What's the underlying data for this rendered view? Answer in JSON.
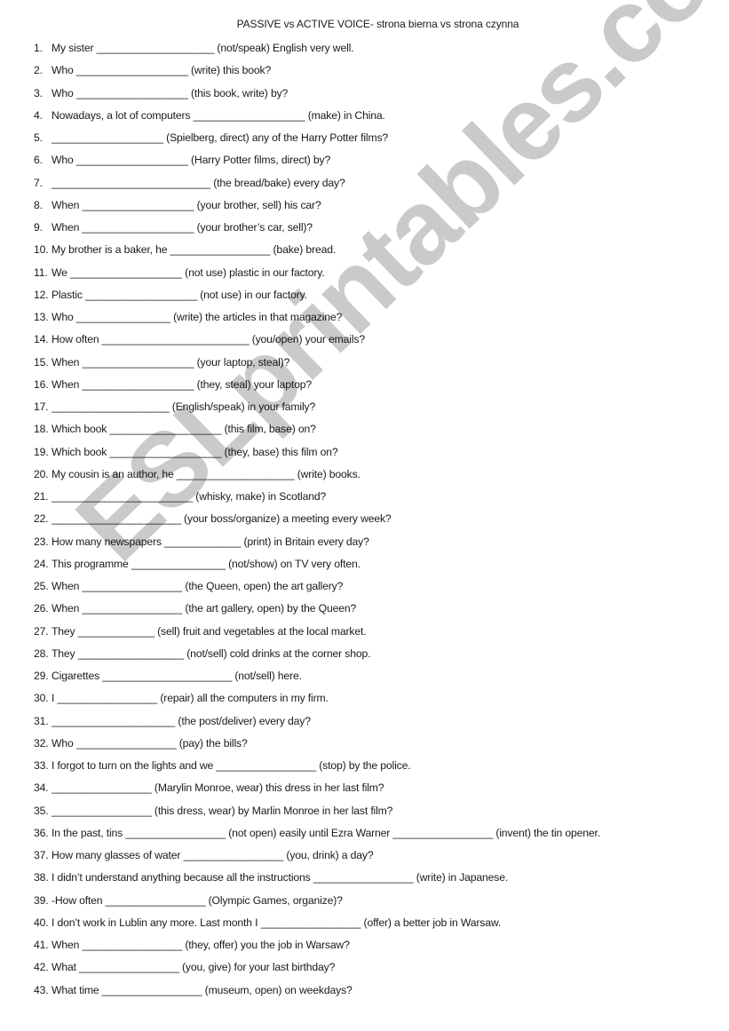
{
  "title": "PASSIVE vs ACTIVE VOICE- strona bierna vs strona czynna",
  "watermark": "ESLprintables.com",
  "items": [
    {
      "num": "1.",
      "text": "My sister ____________________ (not/speak) English very well."
    },
    {
      "num": "2.",
      "text": "Who ___________________ (write) this book?"
    },
    {
      "num": "3.",
      "text": "Who ___________________ (this book, write) by?"
    },
    {
      "num": "4.",
      "text": "Nowadays, a lot of computers ___________________ (make) in China."
    },
    {
      "num": "5.",
      "text": "___________________ (Spielberg, direct) any of the Harry Potter films?"
    },
    {
      "num": "6.",
      "text": "Who ___________________ (Harry Potter films, direct) by?"
    },
    {
      "num": "7.",
      "text": "___________________________ (the bread/bake) every day?"
    },
    {
      "num": "8.",
      "text": "When ___________________ (your brother, sell) his car?"
    },
    {
      "num": "9.",
      "text": "When ___________________ (your brother’s car, sell)?"
    },
    {
      "num": "10.",
      "text": "My brother is a baker, he _________________ (bake) bread."
    },
    {
      "num": "11.",
      "text": "We ___________________ (not use) plastic in our factory."
    },
    {
      "num": "12.",
      "text": "Plastic ___________________ (not use) in our factory."
    },
    {
      "num": "13.",
      "text": "Who ________________ (write) the articles in that magazine?"
    },
    {
      "num": "14.",
      "text": "How often _________________________ (you/open) your emails?"
    },
    {
      "num": "15.",
      "text": "When ___________________ (your laptop, steal)?"
    },
    {
      "num": "16.",
      "text": "When ___________________ (they, steal) your laptop?"
    },
    {
      "num": "17.",
      "text": "____________________ (English/speak) in your family?"
    },
    {
      "num": "18.",
      "text": "Which book ___________________ (this film, base) on?"
    },
    {
      "num": "19.",
      "text": "Which book ___________________ (they, base) this film on?"
    },
    {
      "num": "20.",
      "text": "My cousin is an author, he ____________________ (write) books."
    },
    {
      "num": "21.",
      "text": "________________________ (whisky, make) in Scotland?"
    },
    {
      "num": "22.",
      "text": "______________________ (your boss/organize) a meeting every week?"
    },
    {
      "num": "23.",
      "text": "How many newspapers _____________ (print) in Britain every day?"
    },
    {
      "num": "24.",
      "text": "This programme ________________ (not/show) on TV very often."
    },
    {
      "num": "25.",
      "text": "When _________________ (the Queen, open) the art gallery?"
    },
    {
      "num": "26.",
      "text": "When _________________ (the art gallery, open) by the Queen?"
    },
    {
      "num": "27.",
      "text": "They _____________ (sell) fruit and vegetables at the local market."
    },
    {
      "num": "28.",
      "text": "They __________________ (not/sell) cold drinks at the corner shop."
    },
    {
      "num": "29.",
      "text": "Cigarettes ______________________ (not/sell) here."
    },
    {
      "num": "30.",
      "text": "I _________________ (repair) all the computers in my firm."
    },
    {
      "num": "31.",
      "text": "_____________________ (the post/deliver) every day?"
    },
    {
      "num": "32.",
      "text": "Who _________________ (pay) the bills?"
    },
    {
      "num": "33.",
      "text": "I forgot to turn on the lights and we _________________ (stop) by the police."
    },
    {
      "num": "34.",
      "text": "_________________ (Marylin Monroe, wear) this dress in her last film?"
    },
    {
      "num": "35.",
      "text": "_________________ (this dress, wear) by Marlin Monroe in her last film?"
    },
    {
      "num": "36.",
      "text": "In the past, tins _________________ (not open) easily until Ezra Warner _________________ (invent) the tin opener."
    },
    {
      "num": "37.",
      "text": "How many glasses of water _________________ (you, drink) a day?"
    },
    {
      "num": "38.",
      "text": "I didn’t understand anything because all the instructions _________________ (write) in Japanese."
    },
    {
      "num": "39.",
      "text": "-How often _________________ (Olympic Games, organize)?"
    },
    {
      "num": "40.",
      "text": "I don’t work in Lublin any more. Last month I _________________ (offer) a better job in Warsaw."
    },
    {
      "num": "41.",
      "text": "When _________________ (they, offer) you the job in Warsaw?"
    },
    {
      "num": "42.",
      "text": "What _________________ (you, give) for your last birthday?"
    },
    {
      "num": "43.",
      "text": "What time _________________ (museum, open) on weekdays?"
    }
  ]
}
